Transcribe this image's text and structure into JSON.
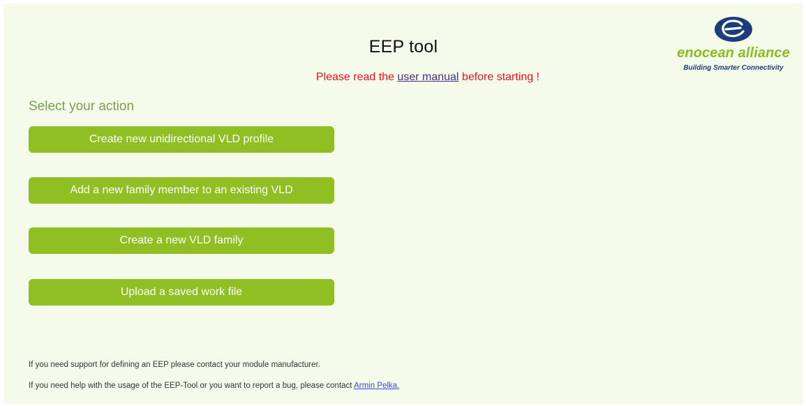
{
  "header": {
    "title": "EEP tool",
    "notice_prefix": "Please read the ",
    "notice_link": "user manual",
    "notice_suffix": " before starting !"
  },
  "logo": {
    "icon": "enocean-emblem-icon",
    "name": "enocean alliance",
    "tagline": "Building Smarter Connectivity"
  },
  "main": {
    "section_heading": "Select your action",
    "actions": [
      {
        "label": "Create new unidirectional VLD profile"
      },
      {
        "label": "Add a new family member to an existing VLD"
      },
      {
        "label": "Create a new VLD family"
      },
      {
        "label": "Upload a saved work file"
      }
    ]
  },
  "footer": {
    "support_text": "If you need support for defining an EEP please contact your module manufacturer.",
    "help_prefix": "If you need help with the usage of the EEP-Tool or you want to report a bug, please contact ",
    "contact_link": "Armin Pelka."
  },
  "colors": {
    "background": "#f5fbea",
    "button": "#8fbf22",
    "button_text": "#ffffff",
    "heading": "#7c9e4e",
    "notice": "#e8121c",
    "logo_green": "#8dba1f",
    "logo_blue": "#1b3d7a",
    "link": "#2b4fd8"
  }
}
